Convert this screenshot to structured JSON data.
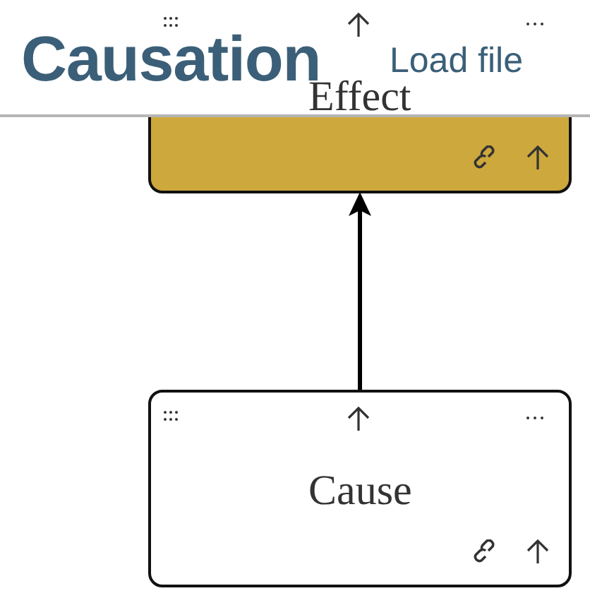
{
  "header": {
    "title": "Causation",
    "load_button": "Load file"
  },
  "nodes": [
    {
      "label": "Effect",
      "color": "#cda83c"
    },
    {
      "label": "Cause",
      "color": "#ffffff"
    }
  ]
}
